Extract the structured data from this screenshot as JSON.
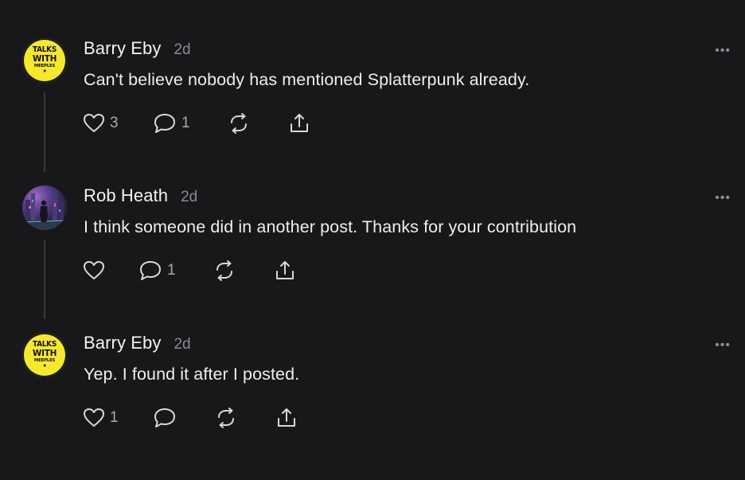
{
  "posts": [
    {
      "author": "Barry Eby",
      "time": "2d",
      "text": "Can't believe nobody has mentioned Splatterpunk already.",
      "avatar": "talks-with-meeples-logo",
      "avatar_text": [
        "TALKS",
        "WITH",
        "MEEPLES",
        "★"
      ],
      "likes": "3",
      "replies": "1",
      "reposts": "",
      "shares": ""
    },
    {
      "author": "Rob Heath",
      "time": "2d",
      "text": "I think someone did in another post. Thanks for your contribution",
      "avatar": "cityscape-figure-image",
      "likes": "",
      "replies": "1",
      "reposts": "",
      "shares": ""
    },
    {
      "author": "Barry Eby",
      "time": "2d",
      "text": "Yep. I found it after I posted.",
      "avatar": "talks-with-meeples-logo",
      "avatar_text": [
        "TALKS",
        "WITH",
        "MEEPLES",
        "★"
      ],
      "likes": "1",
      "replies": "",
      "reposts": "",
      "shares": ""
    }
  ],
  "more_label": "•••",
  "colors": {
    "background": "#18181a",
    "text": "#f1f1f1",
    "muted": "#8b8b90",
    "avatar_yellow": "#f4e92a",
    "thread_line": "#3a3a3e"
  }
}
